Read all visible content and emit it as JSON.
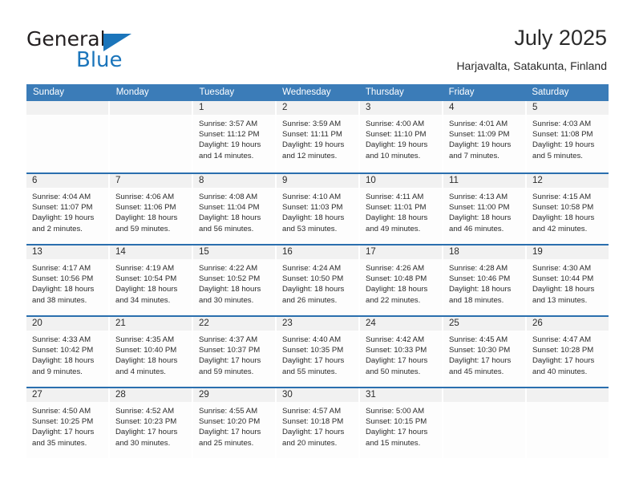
{
  "brand": {
    "name_part1": "General",
    "name_part2": "Blue",
    "triangle_color": "#1b75bb"
  },
  "header": {
    "title": "July 2025",
    "location": "Harjavalta, Satakunta, Finland"
  },
  "theme": {
    "header_bg": "#3b7cb8",
    "week_divider": "#2a6fae",
    "date_bar_bg": "#f1f1f1",
    "cell_bg": "#fdfdfd",
    "text": "#2b2b2b"
  },
  "calendar": {
    "weekday_headers": [
      "Sunday",
      "Monday",
      "Tuesday",
      "Wednesday",
      "Thursday",
      "Friday",
      "Saturday"
    ],
    "labels": {
      "sunrise_prefix": "Sunrise:",
      "sunset_prefix": "Sunset:",
      "daylight_prefix": "Daylight:"
    },
    "weeks": [
      [
        {
          "day": "",
          "sunrise": "",
          "sunset": "",
          "daylight_l1": "",
          "daylight_l2": ""
        },
        {
          "day": "",
          "sunrise": "",
          "sunset": "",
          "daylight_l1": "",
          "daylight_l2": ""
        },
        {
          "day": "1",
          "sunrise": "Sunrise: 3:57 AM",
          "sunset": "Sunset: 11:12 PM",
          "daylight_l1": "Daylight: 19 hours",
          "daylight_l2": "and 14 minutes."
        },
        {
          "day": "2",
          "sunrise": "Sunrise: 3:59 AM",
          "sunset": "Sunset: 11:11 PM",
          "daylight_l1": "Daylight: 19 hours",
          "daylight_l2": "and 12 minutes."
        },
        {
          "day": "3",
          "sunrise": "Sunrise: 4:00 AM",
          "sunset": "Sunset: 11:10 PM",
          "daylight_l1": "Daylight: 19 hours",
          "daylight_l2": "and 10 minutes."
        },
        {
          "day": "4",
          "sunrise": "Sunrise: 4:01 AM",
          "sunset": "Sunset: 11:09 PM",
          "daylight_l1": "Daylight: 19 hours",
          "daylight_l2": "and 7 minutes."
        },
        {
          "day": "5",
          "sunrise": "Sunrise: 4:03 AM",
          "sunset": "Sunset: 11:08 PM",
          "daylight_l1": "Daylight: 19 hours",
          "daylight_l2": "and 5 minutes."
        }
      ],
      [
        {
          "day": "6",
          "sunrise": "Sunrise: 4:04 AM",
          "sunset": "Sunset: 11:07 PM",
          "daylight_l1": "Daylight: 19 hours",
          "daylight_l2": "and 2 minutes."
        },
        {
          "day": "7",
          "sunrise": "Sunrise: 4:06 AM",
          "sunset": "Sunset: 11:06 PM",
          "daylight_l1": "Daylight: 18 hours",
          "daylight_l2": "and 59 minutes."
        },
        {
          "day": "8",
          "sunrise": "Sunrise: 4:08 AM",
          "sunset": "Sunset: 11:04 PM",
          "daylight_l1": "Daylight: 18 hours",
          "daylight_l2": "and 56 minutes."
        },
        {
          "day": "9",
          "sunrise": "Sunrise: 4:10 AM",
          "sunset": "Sunset: 11:03 PM",
          "daylight_l1": "Daylight: 18 hours",
          "daylight_l2": "and 53 minutes."
        },
        {
          "day": "10",
          "sunrise": "Sunrise: 4:11 AM",
          "sunset": "Sunset: 11:01 PM",
          "daylight_l1": "Daylight: 18 hours",
          "daylight_l2": "and 49 minutes."
        },
        {
          "day": "11",
          "sunrise": "Sunrise: 4:13 AM",
          "sunset": "Sunset: 11:00 PM",
          "daylight_l1": "Daylight: 18 hours",
          "daylight_l2": "and 46 minutes."
        },
        {
          "day": "12",
          "sunrise": "Sunrise: 4:15 AM",
          "sunset": "Sunset: 10:58 PM",
          "daylight_l1": "Daylight: 18 hours",
          "daylight_l2": "and 42 minutes."
        }
      ],
      [
        {
          "day": "13",
          "sunrise": "Sunrise: 4:17 AM",
          "sunset": "Sunset: 10:56 PM",
          "daylight_l1": "Daylight: 18 hours",
          "daylight_l2": "and 38 minutes."
        },
        {
          "day": "14",
          "sunrise": "Sunrise: 4:19 AM",
          "sunset": "Sunset: 10:54 PM",
          "daylight_l1": "Daylight: 18 hours",
          "daylight_l2": "and 34 minutes."
        },
        {
          "day": "15",
          "sunrise": "Sunrise: 4:22 AM",
          "sunset": "Sunset: 10:52 PM",
          "daylight_l1": "Daylight: 18 hours",
          "daylight_l2": "and 30 minutes."
        },
        {
          "day": "16",
          "sunrise": "Sunrise: 4:24 AM",
          "sunset": "Sunset: 10:50 PM",
          "daylight_l1": "Daylight: 18 hours",
          "daylight_l2": "and 26 minutes."
        },
        {
          "day": "17",
          "sunrise": "Sunrise: 4:26 AM",
          "sunset": "Sunset: 10:48 PM",
          "daylight_l1": "Daylight: 18 hours",
          "daylight_l2": "and 22 minutes."
        },
        {
          "day": "18",
          "sunrise": "Sunrise: 4:28 AM",
          "sunset": "Sunset: 10:46 PM",
          "daylight_l1": "Daylight: 18 hours",
          "daylight_l2": "and 18 minutes."
        },
        {
          "day": "19",
          "sunrise": "Sunrise: 4:30 AM",
          "sunset": "Sunset: 10:44 PM",
          "daylight_l1": "Daylight: 18 hours",
          "daylight_l2": "and 13 minutes."
        }
      ],
      [
        {
          "day": "20",
          "sunrise": "Sunrise: 4:33 AM",
          "sunset": "Sunset: 10:42 PM",
          "daylight_l1": "Daylight: 18 hours",
          "daylight_l2": "and 9 minutes."
        },
        {
          "day": "21",
          "sunrise": "Sunrise: 4:35 AM",
          "sunset": "Sunset: 10:40 PM",
          "daylight_l1": "Daylight: 18 hours",
          "daylight_l2": "and 4 minutes."
        },
        {
          "day": "22",
          "sunrise": "Sunrise: 4:37 AM",
          "sunset": "Sunset: 10:37 PM",
          "daylight_l1": "Daylight: 17 hours",
          "daylight_l2": "and 59 minutes."
        },
        {
          "day": "23",
          "sunrise": "Sunrise: 4:40 AM",
          "sunset": "Sunset: 10:35 PM",
          "daylight_l1": "Daylight: 17 hours",
          "daylight_l2": "and 55 minutes."
        },
        {
          "day": "24",
          "sunrise": "Sunrise: 4:42 AM",
          "sunset": "Sunset: 10:33 PM",
          "daylight_l1": "Daylight: 17 hours",
          "daylight_l2": "and 50 minutes."
        },
        {
          "day": "25",
          "sunrise": "Sunrise: 4:45 AM",
          "sunset": "Sunset: 10:30 PM",
          "daylight_l1": "Daylight: 17 hours",
          "daylight_l2": "and 45 minutes."
        },
        {
          "day": "26",
          "sunrise": "Sunrise: 4:47 AM",
          "sunset": "Sunset: 10:28 PM",
          "daylight_l1": "Daylight: 17 hours",
          "daylight_l2": "and 40 minutes."
        }
      ],
      [
        {
          "day": "27",
          "sunrise": "Sunrise: 4:50 AM",
          "sunset": "Sunset: 10:25 PM",
          "daylight_l1": "Daylight: 17 hours",
          "daylight_l2": "and 35 minutes."
        },
        {
          "day": "28",
          "sunrise": "Sunrise: 4:52 AM",
          "sunset": "Sunset: 10:23 PM",
          "daylight_l1": "Daylight: 17 hours",
          "daylight_l2": "and 30 minutes."
        },
        {
          "day": "29",
          "sunrise": "Sunrise: 4:55 AM",
          "sunset": "Sunset: 10:20 PM",
          "daylight_l1": "Daylight: 17 hours",
          "daylight_l2": "and 25 minutes."
        },
        {
          "day": "30",
          "sunrise": "Sunrise: 4:57 AM",
          "sunset": "Sunset: 10:18 PM",
          "daylight_l1": "Daylight: 17 hours",
          "daylight_l2": "and 20 minutes."
        },
        {
          "day": "31",
          "sunrise": "Sunrise: 5:00 AM",
          "sunset": "Sunset: 10:15 PM",
          "daylight_l1": "Daylight: 17 hours",
          "daylight_l2": "and 15 minutes."
        },
        {
          "day": "",
          "sunrise": "",
          "sunset": "",
          "daylight_l1": "",
          "daylight_l2": ""
        },
        {
          "day": "",
          "sunrise": "",
          "sunset": "",
          "daylight_l1": "",
          "daylight_l2": ""
        }
      ]
    ]
  }
}
